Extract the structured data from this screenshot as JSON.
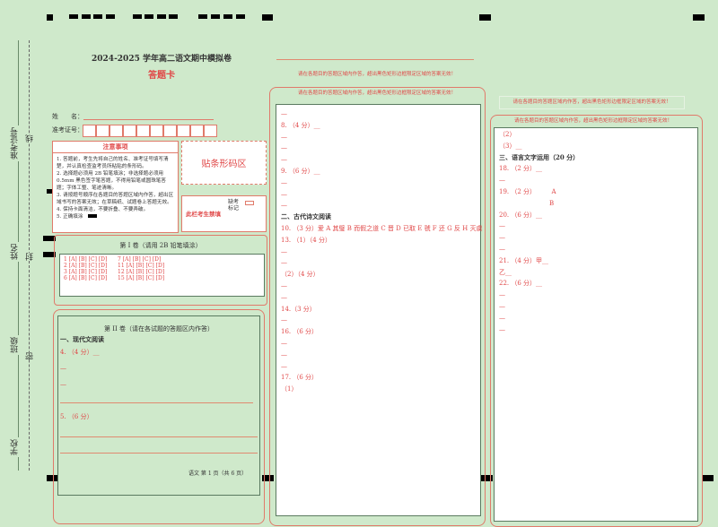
{
  "header": {
    "title": "2024-2025 学年高二语文期中模拟卷",
    "subtitle": "答题卡"
  },
  "binding_labels": {
    "exam_no": "准考证号",
    "name": "姓名",
    "class": "班级",
    "school": "学校",
    "line": "线",
    "seal": "封",
    "secret": "密"
  },
  "form": {
    "name_label": "姓　　名：",
    "exam_no_label": "准考证号："
  },
  "notice": {
    "title": "注意事项",
    "items": [
      "1. 答题前，考生先将自己的姓名、准考证号填写清楚，并认真检查监考员所粘贴的条形码。",
      "2. 选择题必须用 2B 铅笔填涂；非选择题必须用 0.5mm 黑色签字笔答题，不得用铅笔或圆珠笔答题；字体工整、笔迹清晰。",
      "3. 请按题号顺序在各题目的答题区域内作答，超出区域书写的答案无效；在草稿纸、试题卷上答题无效。",
      "4. 保持卡面清洁，不要折叠、不要弄破。",
      "5. 正确填涂"
    ]
  },
  "barcode": {
    "label": "贴条形码区"
  },
  "forbidden": {
    "label": "此栏考生禁填",
    "absent": "缺考标记"
  },
  "part1": {
    "title": "第 I 卷（请用 2B 铅笔填涂）",
    "col1": [
      "1 [A] [B] [C] [D]",
      "2 [A] [B] [C] [D]",
      "3 [A] [B] [C] [D]",
      "6 [A] [B] [C] [D]"
    ],
    "col2": [
      "7 [A] [B] [C] [D]",
      "11 [A] [B] [C] [D]",
      "12 [A] [B] [C] [D]",
      "15 [A] [B] [C] [D]"
    ]
  },
  "part2": {
    "title": "第 II 卷（请在各试题的答题区内作答）",
    "section1": "一、现代文阅读",
    "q4": "4. （4 分）__",
    "dash": "—",
    "q5": "5. （6 分）",
    "footer": "语文  第 1 页（共 6 页）"
  },
  "warning": "请在各题目的答题区域内作答，超出黑色矩形边框限定区域的答案无效！",
  "middle": {
    "items": [
      {
        "t": "—"
      },
      {
        "t": "8. （4 分）__"
      },
      {
        "t": "—"
      },
      {
        "t": "—"
      },
      {
        "t": "—"
      },
      {
        "t": "9. （6 分）__"
      },
      {
        "t": "—"
      },
      {
        "t": "—"
      },
      {
        "t": "—"
      },
      {
        "t": "二、古代诗文阅读",
        "h": true
      },
      {
        "t": "10. （3 分）爱 A 其璧 B 而假之道 C 晋 D 已取 E 虢 F 还 G 反 H 灭虞"
      },
      {
        "t": "13. （1）（4 分）"
      },
      {
        "t": "—"
      },
      {
        "t": "—"
      },
      {
        "t": "（2）（4 分）"
      },
      {
        "t": "—"
      },
      {
        "t": "—"
      },
      {
        "t": "14.（3 分）"
      },
      {
        "t": "—"
      },
      {
        "t": "16. （6 分）"
      },
      {
        "t": "—"
      },
      {
        "t": "—"
      },
      {
        "t": "—"
      },
      {
        "t": "17. （6 分）"
      },
      {
        "t": "（1）"
      }
    ]
  },
  "right": {
    "items": [
      {
        "t": "（2）"
      },
      {
        "t": "（3）__"
      },
      {
        "t": "三、语言文字运用（20 分）",
        "h": true
      },
      {
        "t": "18. （2 分）__"
      },
      {
        "t": "—"
      },
      {
        "t": "19. （2 分）　　　A"
      },
      {
        "t": "　　　　　　　　B"
      },
      {
        "t": "20. （6 分）__"
      },
      {
        "t": "—"
      },
      {
        "t": "—"
      },
      {
        "t": "—"
      },
      {
        "t": "21. （4 分）甲__"
      },
      {
        "t": "乙__"
      },
      {
        "t": "22. （6 分）__"
      },
      {
        "t": "—"
      },
      {
        "t": "—"
      },
      {
        "t": "—"
      },
      {
        "t": "—"
      }
    ]
  }
}
